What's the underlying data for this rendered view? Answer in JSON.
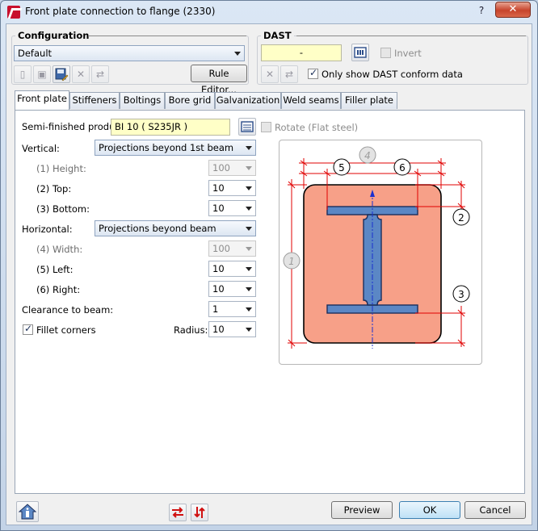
{
  "window": {
    "title": "Front plate connection to flange (2330)",
    "help_label": "?",
    "close_label": "✕"
  },
  "configuration": {
    "title": "Configuration",
    "selected": "Default",
    "rule_editor_label": "Rule Editor..."
  },
  "dast": {
    "title": "DAST",
    "value": "-",
    "invert_label": "Invert",
    "invert_checked": false,
    "only_conform_label": "Only show DAST conform data",
    "only_conform_checked": true
  },
  "tabs": [
    "Front plate",
    "Stiffeners",
    "Boltings",
    "Bore grid",
    "Galvanization",
    "Weld seams",
    "Filler plate"
  ],
  "active_tab": "Front plate",
  "front_plate": {
    "semi_finished_label": "Semi-finished produ",
    "semi_finished_value": "BI 10  ( S235JR )",
    "rotate_label": "Rotate (Flat steel)",
    "vertical_label": "Vertical:",
    "vertical_value": "Projections beyond 1st beam",
    "height_label": "(1) Height:",
    "height_value": "100",
    "top_label": "(2) Top:",
    "top_value": "10",
    "bottom_label": "(3) Bottom:",
    "bottom_value": "10",
    "horizontal_label": "Horizontal:",
    "horizontal_value": "Projections beyond beam",
    "width_label": "(4) Width:",
    "width_value": "100",
    "left_label": "(5) Left:",
    "left_value": "10",
    "right_label": "(6) Right:",
    "right_value": "10",
    "clearance_label": "Clearance to beam:",
    "clearance_value": "1",
    "fillet_label": "Fillet corners",
    "fillet_checked": true,
    "radius_label": "Radius:",
    "radius_value": "10"
  },
  "diagram": {
    "callouts": [
      "1",
      "2",
      "3",
      "4",
      "5",
      "6"
    ],
    "colors": {
      "plate": "#f7a088",
      "beam": "#5b87c5",
      "dim": "#e00000",
      "axis": "#1a2fd0"
    }
  },
  "footer": {
    "preview_label": "Preview",
    "ok_label": "OK",
    "cancel_label": "Cancel"
  }
}
